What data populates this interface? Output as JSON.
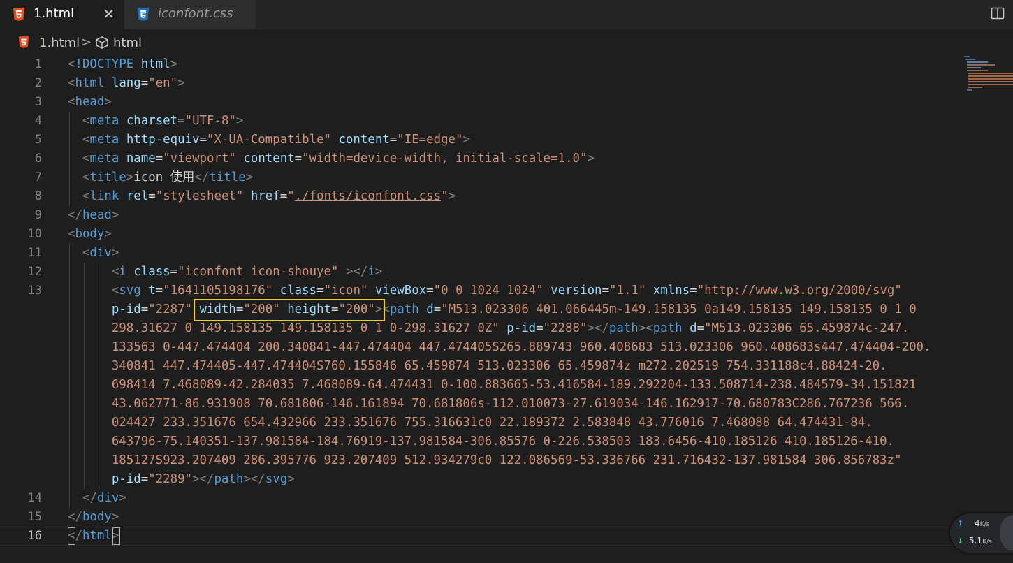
{
  "tabs": [
    {
      "label": "1.html",
      "icon": "html5-icon",
      "active": true
    },
    {
      "label": "iconfont.css",
      "icon": "css3-icon",
      "active": false
    }
  ],
  "breadcrumb": {
    "file": "1.html",
    "separator": ">",
    "node": "html"
  },
  "line_numbers": [
    "1",
    "2",
    "3",
    "4",
    "5",
    "6",
    "7",
    "8",
    "9",
    "10",
    "11",
    "12",
    "13",
    "14",
    "15",
    "16"
  ],
  "code": {
    "l1": {
      "lt": "<",
      "doctype": "!DOCTYPE",
      "html": "html",
      "gt": ">"
    },
    "l2": {
      "lt": "<",
      "tag": "html",
      "attr": "lang",
      "eq": "=",
      "val": "\"en\"",
      "gt": ">"
    },
    "l3": {
      "lt": "<",
      "tag": "head",
      "gt": ">"
    },
    "l4": {
      "lt": "<",
      "tag": "meta",
      "attr": "charset",
      "eq": "=",
      "val": "\"UTF-8\"",
      "gt": ">"
    },
    "l5": {
      "lt": "<",
      "tag": "meta",
      "attr1": "http-equiv",
      "val1": "\"X-UA-Compatible\"",
      "attr2": "content",
      "val2": "\"IE=edge\"",
      "gt": ">"
    },
    "l6": {
      "lt": "<",
      "tag": "meta",
      "attr1": "name",
      "val1": "\"viewport\"",
      "attr2": "content",
      "val2": "\"width=device-width, initial-scale=1.0\"",
      "gt": ">"
    },
    "l7": {
      "lt": "<",
      "tag": "title",
      "text": "icon 使用",
      "close": "</",
      "gt": ">"
    },
    "l8": {
      "lt": "<",
      "tag": "link",
      "attr1": "rel",
      "val1": "\"stylesheet\"",
      "attr2": "href",
      "q": "\"",
      "url": "./fonts/iconfont.css",
      "gt": ">"
    },
    "l9": {
      "close": "</",
      "tag": "head",
      "gt": ">"
    },
    "l10": {
      "lt": "<",
      "tag": "body",
      "gt": ">"
    },
    "l11": {
      "lt": "<",
      "tag": "div",
      "gt": ">"
    },
    "l12": {
      "lt": "<",
      "tag": "i",
      "attr": "class",
      "val": "\"iconfont icon-shouye\"",
      "gt2": " ></",
      "gt": ">"
    },
    "l13a": {
      "lt": "<",
      "tag": "svg",
      "a1": "t",
      "v1": "\"1641105198176\"",
      "a2": "class",
      "v2": "\"icon\"",
      "a3": "viewBox",
      "v3": "\"0 0 1024 1024\"",
      "a4": "version",
      "v4": "\"1.1\"",
      "a5": "xmlns",
      "url": "http://www.w3.org/2000/svg"
    },
    "l13b": {
      "a1": "p-id",
      "v1": "\"2287\"",
      "a2": "width",
      "v2": "\"200\"",
      "a3": "height",
      "v3": "\"200\"",
      "tag": "path",
      "a4": "d",
      "v4": "\"M513.023306 401.066445m-149.158135 0a149.158135 149.158135 0 1 0"
    },
    "l13c": {
      "v": "298.31627 0 149.158135 149.158135 0 1 0-298.31627 0Z\"",
      "a1": "p-id",
      "v1": "\"2288\"",
      "tag": "path",
      "tag2": "path",
      "a2": "d",
      "v2": "\"M513.023306 65.459874c-247."
    },
    "l13d": "133563 0-447.474404 200.340841-447.474404 447.474405S265.889743 960.408683 513.023306 960.408683s447.474404-200.",
    "l13e": "340841 447.474405-447.474404S760.155846 65.459874 513.023306 65.459874z m272.202519 754.331188c4.88424-20.",
    "l13f": "698414 7.468089-42.284035 7.468089-64.474431 0-100.883665-53.416584-189.292204-133.508714-238.484579-34.151821",
    "l13g": "43.062771-86.931908 70.681806-146.161894 70.681806s-112.010073-27.619034-146.162917-70.680783C286.767236 566.",
    "l13h": "024427 233.351676 654.432966 233.351676 755.316631c0 22.189372 2.583848 43.776016 7.468088 64.474431-84.",
    "l13i": "643796-75.140351-137.981584-184.76919-137.981584-306.85576 0-226.538503 183.6456-410.185126 410.185126-410.",
    "l13j": "185127S923.207409 286.395776 923.207409 512.934279c0 122.086569-53.336766 231.716432-137.981584 306.856783z\"",
    "l13k": {
      "a1": "p-id",
      "v1": "\"2289\"",
      "tag1": "path",
      "tag2": "svg"
    },
    "l14": {
      "close": "</",
      "tag": "div",
      "gt": ">"
    },
    "l15": {
      "close": "</",
      "tag": "body",
      "gt": ">"
    },
    "l16": {
      "close": "</",
      "tag": "html",
      "gt": ">"
    }
  },
  "net": {
    "up_value": "4",
    "up_unit": "K/s",
    "down_value": "5.1",
    "down_unit": "K/s"
  },
  "colors": {
    "tag": "#569cd6",
    "attr": "#9cdcfe",
    "string": "#ce9178",
    "bracket": "#808080",
    "highlight": "#f5d313"
  }
}
